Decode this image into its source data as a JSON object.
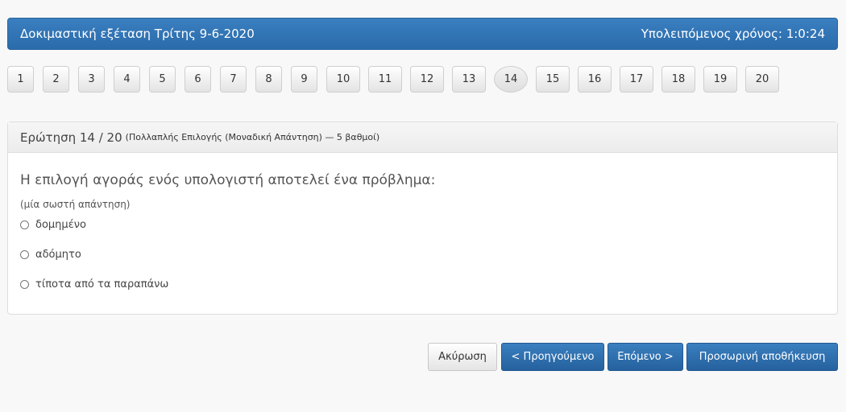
{
  "header": {
    "title": "Δοκιμαστική εξέταση Τρίτης 9-6-2020",
    "timer": "Υπολειπόμενος χρόνος: 1:0:24"
  },
  "nav": {
    "questions": [
      "1",
      "2",
      "3",
      "4",
      "5",
      "6",
      "7",
      "8",
      "9",
      "10",
      "11",
      "12",
      "13",
      "14",
      "15",
      "16",
      "17",
      "18",
      "19",
      "20"
    ],
    "current": "14"
  },
  "panel": {
    "heading": "Ερώτηση 14 / 20",
    "heading_sub": "(Πολλαπλής Επιλογής (Μοναδική Απάντηση) — 5 βαθμοί)",
    "question": "Η επιλογή αγοράς ενός υπολογιστή αποτελεί ένα πρόβλημα:",
    "hint": "(μία σωστή απάντηση)",
    "options": [
      "δομημένο",
      "αδόμητο",
      "τίποτα από τα παραπάνω"
    ]
  },
  "actions": {
    "cancel": "Ακύρωση",
    "previous": "< Προηγούμενο",
    "next": "Επόμενο >",
    "save": "Προσωρινή αποθήκευση"
  }
}
